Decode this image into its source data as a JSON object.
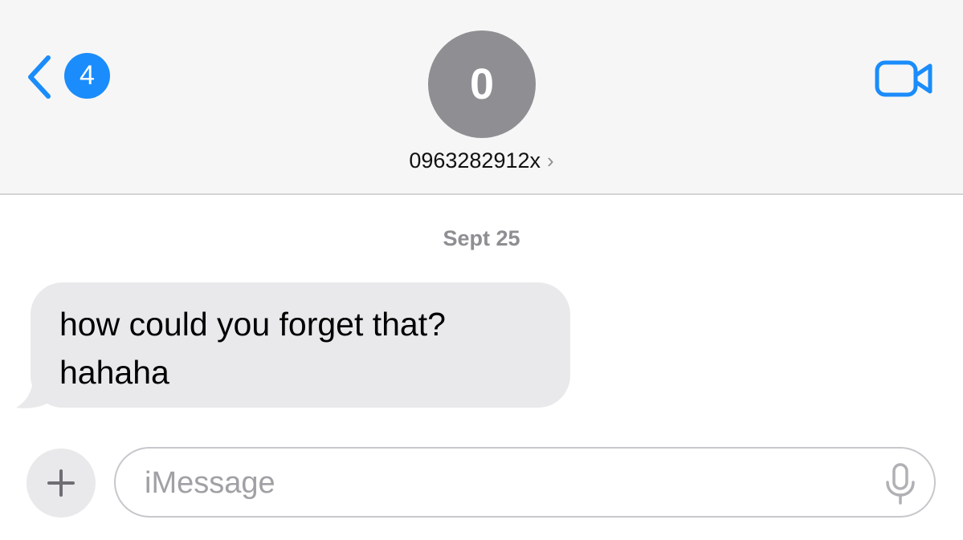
{
  "header": {
    "back_badge_count": "4",
    "avatar_initial": "0",
    "contact_name": "0963282912x",
    "contact_chevron": "›"
  },
  "conversation": {
    "date_label": "Sept 25",
    "messages": [
      {
        "direction": "incoming",
        "text": "how could you forget that?\nhahaha"
      }
    ]
  },
  "composer": {
    "placeholder": "iMessage",
    "value": ""
  },
  "icons": {
    "back": "chevron-left-icon",
    "video": "video-camera-icon",
    "add": "plus-icon",
    "mic": "microphone-icon"
  },
  "colors": {
    "accent": "#1a8cfb",
    "header_bg": "#f6f6f6",
    "avatar_bg": "#8e8e93",
    "incoming_bubble": "#e9e9eb",
    "secondary_text": "#8e8e93"
  }
}
